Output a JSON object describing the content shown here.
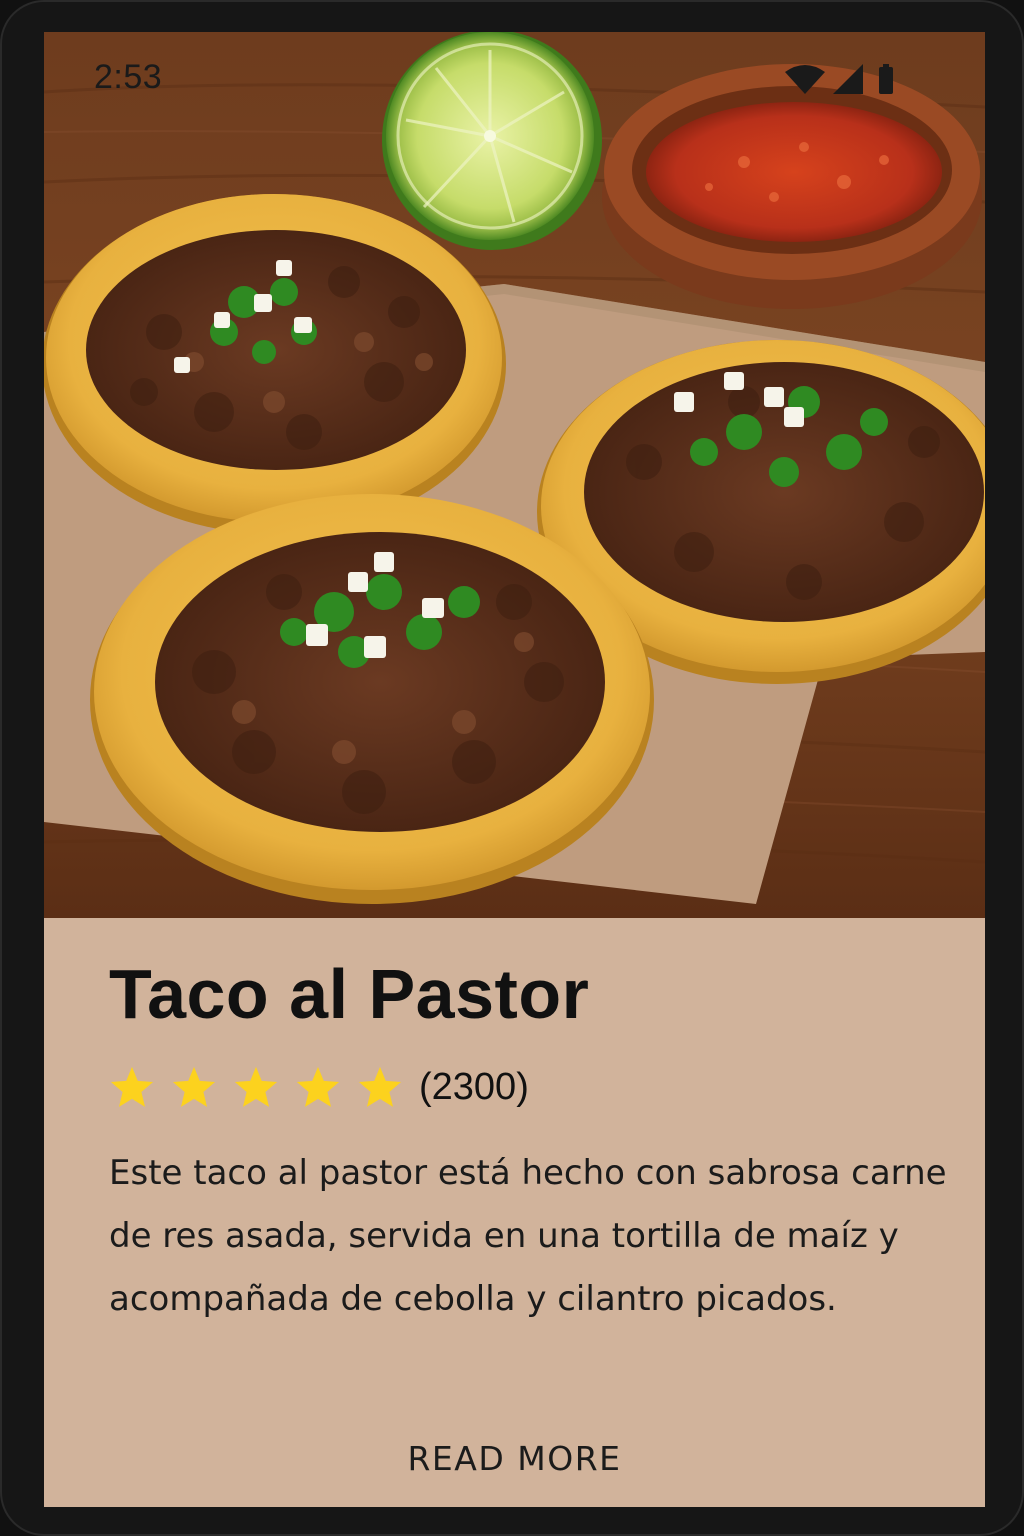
{
  "status_bar": {
    "time": "2:53",
    "icons": [
      "wifi-icon",
      "cellular-signal-icon",
      "battery-icon"
    ]
  },
  "hero_image": {
    "description_icon": "taco-photo"
  },
  "card": {
    "title": "Taco al Pastor",
    "rating": {
      "stars": 5,
      "max_stars": 5,
      "count_label": "(2300)"
    },
    "description": "Este taco al pastor está hecho con sabrosa carne de res asada, servida en una tortilla de maíz y acompañada de cebolla y cilantro picados.",
    "read_more_label": "READ MORE"
  },
  "colors": {
    "card_background": "#d1b39b",
    "star": "#fcd21e",
    "text": "#111111"
  }
}
